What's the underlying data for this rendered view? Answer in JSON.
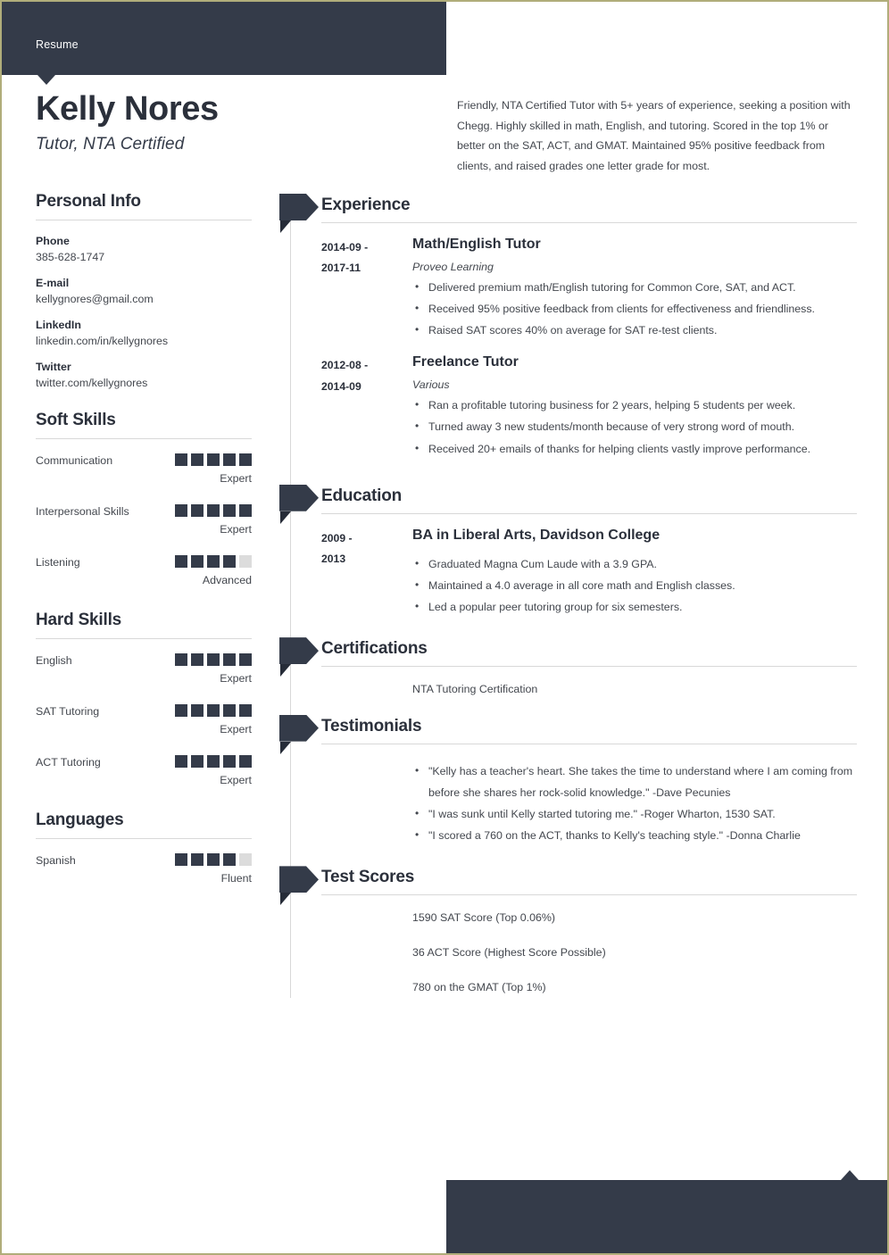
{
  "document": {
    "header_label": "Resume",
    "name": "Kelly Nores",
    "title": "Tutor, NTA Certified",
    "summary": "Friendly, NTA Certified Tutor with 5+ years of experience, seeking a position with Chegg. Highly skilled in math, English, and tutoring. Scored in the top 1% or better on the SAT, ACT, and GMAT. Maintained 95% positive feedback from clients, and raised grades one letter grade for most."
  },
  "colors": {
    "accent_dark": "#343b49",
    "accent_fold": "#262c38",
    "text_dark": "#2b303b",
    "text_body": "#43474e",
    "rule": "#d8d8d8",
    "square_empty": "#dcdcdc",
    "page_border": "#b0ad7a"
  },
  "sidebar": {
    "personal_info": {
      "heading": "Personal Info",
      "items": [
        {
          "label": "Phone",
          "value": "385-628-1747"
        },
        {
          "label": "E-mail",
          "value": "kellygnores@gmail.com"
        },
        {
          "label": "LinkedIn",
          "value": "linkedin.com/in/kellygnores"
        },
        {
          "label": "Twitter",
          "value": "twitter.com/kellygnores"
        }
      ]
    },
    "soft_skills": {
      "heading": "Soft Skills",
      "max": 5,
      "items": [
        {
          "name": "Communication",
          "rating": 5,
          "level": "Expert"
        },
        {
          "name": "Interpersonal Skills",
          "rating": 5,
          "level": "Expert"
        },
        {
          "name": "Listening",
          "rating": 4,
          "level": "Advanced"
        }
      ]
    },
    "hard_skills": {
      "heading": "Hard Skills",
      "max": 5,
      "items": [
        {
          "name": "English",
          "rating": 5,
          "level": "Expert"
        },
        {
          "name": "SAT Tutoring",
          "rating": 5,
          "level": "Expert"
        },
        {
          "name": "ACT Tutoring",
          "rating": 5,
          "level": "Expert"
        }
      ]
    },
    "languages": {
      "heading": "Languages",
      "max": 5,
      "items": [
        {
          "name": "Spanish",
          "rating": 4,
          "level": "Fluent"
        }
      ]
    }
  },
  "main": {
    "experience": {
      "heading": "Experience",
      "entries": [
        {
          "date_start": "2014-09 -",
          "date_end": "2017-11",
          "title": "Math/English Tutor",
          "org": "Proveo Learning",
          "bullets": [
            "Delivered premium math/English tutoring for Common Core, SAT, and ACT.",
            "Received 95% positive feedback from clients for effectiveness and friendliness.",
            "Raised SAT scores 40% on average for SAT re-test clients."
          ]
        },
        {
          "date_start": "2012-08 -",
          "date_end": "2014-09",
          "title": "Freelance Tutor",
          "org": "Various",
          "bullets": [
            "Ran a profitable tutoring business for 2 years, helping 5 students per week.",
            "Turned away 3 new students/month because of very strong word of mouth.",
            "Received 20+ emails of thanks for helping clients vastly improve performance."
          ]
        }
      ]
    },
    "education": {
      "heading": "Education",
      "entries": [
        {
          "date_start": "2009 -",
          "date_end": "2013",
          "title": "BA in Liberal Arts, Davidson College",
          "bullets": [
            "Graduated Magna Cum Laude with a 3.9 GPA.",
            "Maintained a 4.0 average in all core math and English classes.",
            "Led a popular peer tutoring group for six semesters."
          ]
        }
      ]
    },
    "certifications": {
      "heading": "Certifications",
      "lines": [
        "NTA Tutoring Certification"
      ]
    },
    "testimonials": {
      "heading": "Testimonials",
      "bullets": [
        "\"Kelly has a teacher's heart. She takes the time to understand where I am coming from before she shares her rock-solid knowledge.\" -Dave Pecunies",
        "\"I was sunk until Kelly started tutoring me.\" -Roger Wharton, 1530 SAT.",
        "\"I scored a 760 on the ACT, thanks to Kelly's teaching style.\" -Donna Charlie"
      ]
    },
    "test_scores": {
      "heading": "Test Scores",
      "lines": [
        "1590 SAT Score (Top 0.06%)",
        "36 ACT Score (Highest Score Possible)",
        "780 on the GMAT  (Top 1%)"
      ]
    }
  }
}
